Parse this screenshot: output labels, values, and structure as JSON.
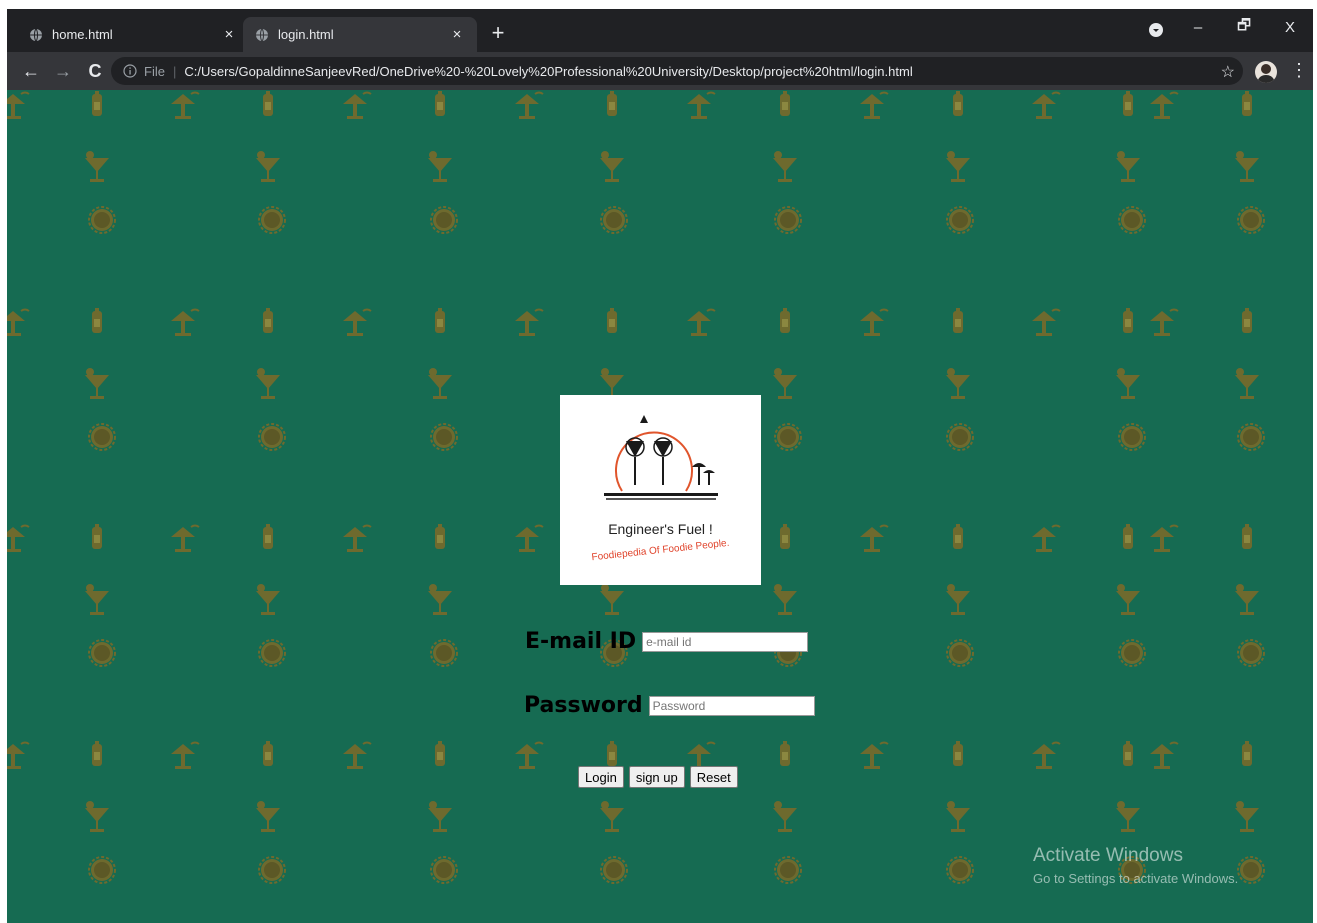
{
  "tabs": [
    {
      "title": "home.html",
      "close": "×",
      "active": false
    },
    {
      "title": "login.html",
      "close": "×",
      "active": true
    }
  ],
  "new_tab_label": "+",
  "window_controls": {
    "minimize": "–",
    "maximize": "🗗",
    "close": "X"
  },
  "toolbar": {
    "back": "←",
    "forward": "→",
    "reload": "C",
    "scheme": "File",
    "separator": "|",
    "url": "C:/Users/GopaldinneSanjeevRed/OneDrive%20-%20Lovely%20Professional%20University/Desktop/project%20html/login.html",
    "bookmark": "☆",
    "menu": "⋮"
  },
  "logo": {
    "name": "Engineer's Fuel !",
    "tagline": "Foodiepedia Of Foodie People."
  },
  "form": {
    "email_label": "E-mail ID",
    "email_placeholder": "e-mail id",
    "password_label": "Password",
    "password_placeholder": "Password"
  },
  "buttons": {
    "login": "Login",
    "signup": "sign up",
    "reset": "Reset"
  },
  "watermark": {
    "title": "Activate Windows",
    "subtitle": "Go to Settings to activate Windows."
  },
  "colors": {
    "page_background": "#166b52",
    "pattern_icon": "#6e6a2e",
    "tabstrip": "#202124",
    "toolbar": "#35363a"
  }
}
